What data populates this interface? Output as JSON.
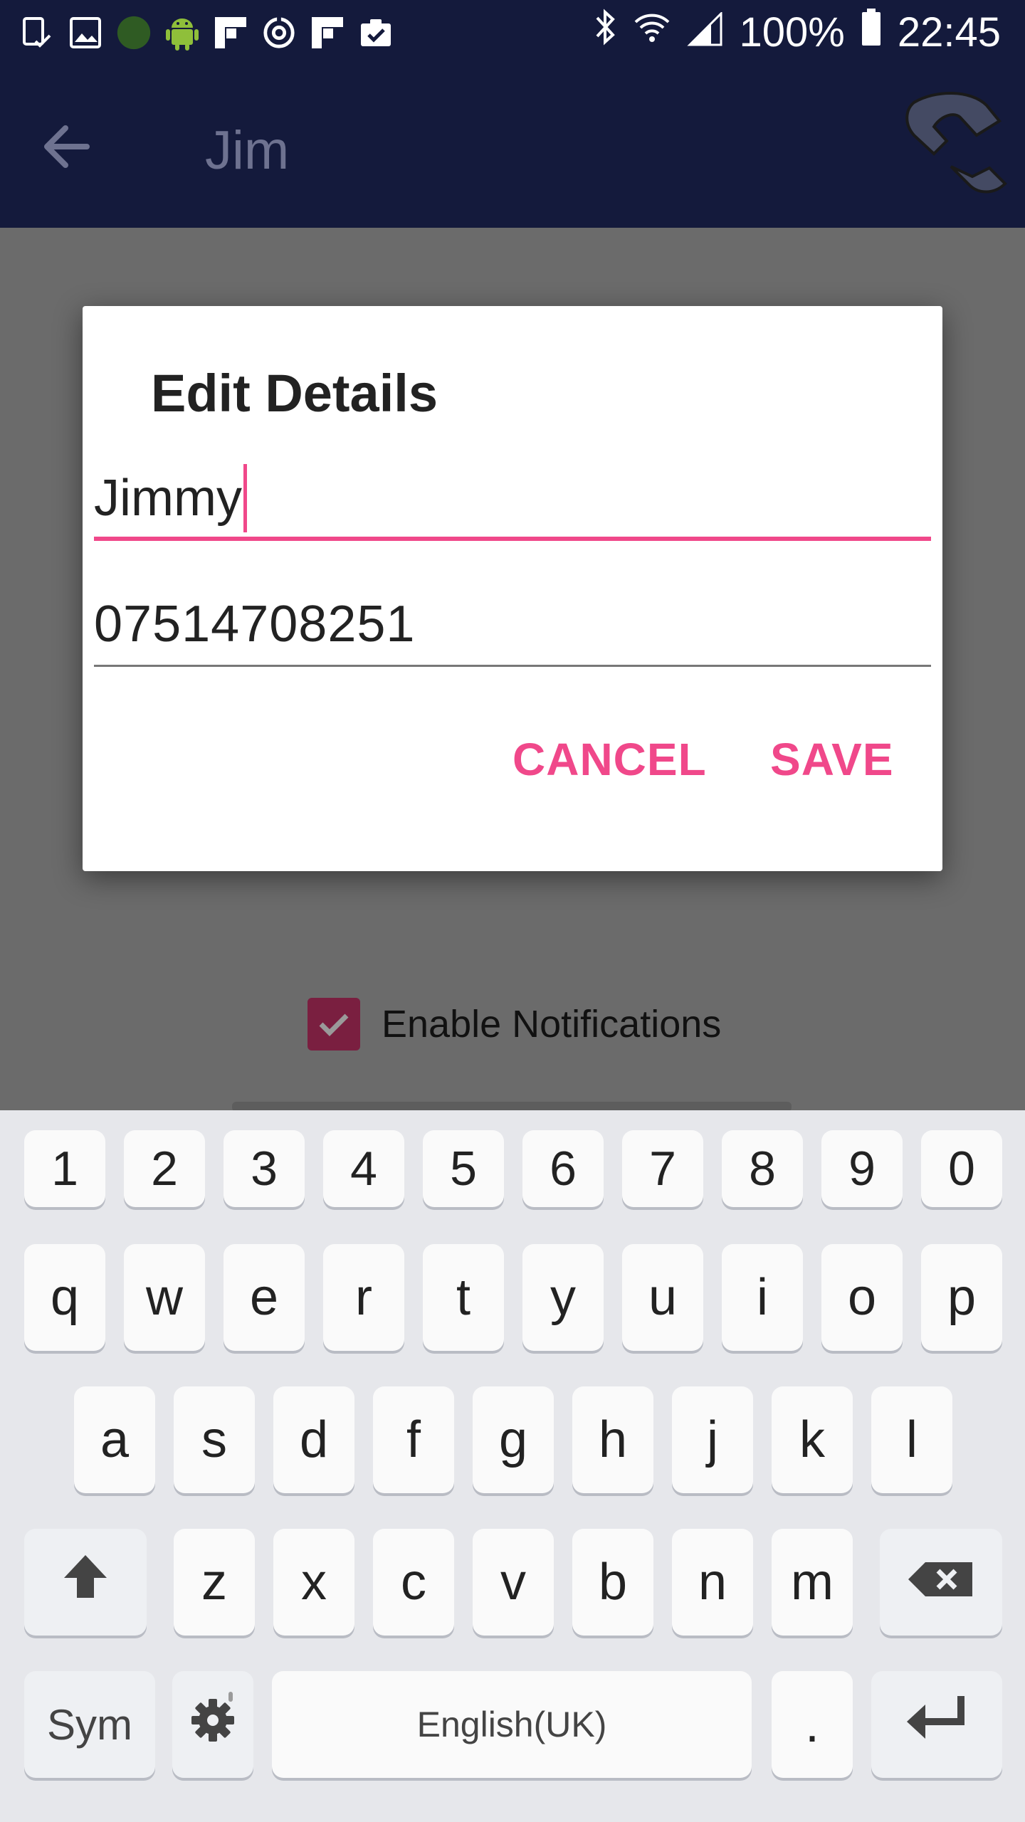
{
  "status_bar": {
    "left_icons": [
      "tablet-check-icon",
      "image-icon",
      "green-circle-icon",
      "android-icon",
      "flipboard-icon",
      "sync-circle-icon",
      "flipboard-icon",
      "clipboard-check-icon"
    ],
    "battery_text": "100%",
    "time": "22:45"
  },
  "app_bar": {
    "title": "Jim"
  },
  "background": {
    "notifications_label": "Enable Notifications",
    "notifications_checked": true
  },
  "dialog": {
    "title": "Edit Details",
    "name_value": "Jimmy",
    "phone_value": "07514708251",
    "cancel_label": "CANCEL",
    "save_label": "SAVE"
  },
  "keyboard": {
    "numbers": [
      "1",
      "2",
      "3",
      "4",
      "5",
      "6",
      "7",
      "8",
      "9",
      "0"
    ],
    "row1": [
      "q",
      "w",
      "e",
      "r",
      "t",
      "y",
      "u",
      "i",
      "o",
      "p"
    ],
    "row2": [
      "a",
      "s",
      "d",
      "f",
      "g",
      "h",
      "j",
      "k",
      "l"
    ],
    "row3": [
      "z",
      "x",
      "c",
      "v",
      "b",
      "n",
      "m"
    ],
    "sym_label": "Sym",
    "space_label": "English(UK)",
    "period_label": "."
  },
  "colors": {
    "accent": "#f0488a",
    "appbar": "#141a3c",
    "checkbox": "#7a1f40"
  }
}
